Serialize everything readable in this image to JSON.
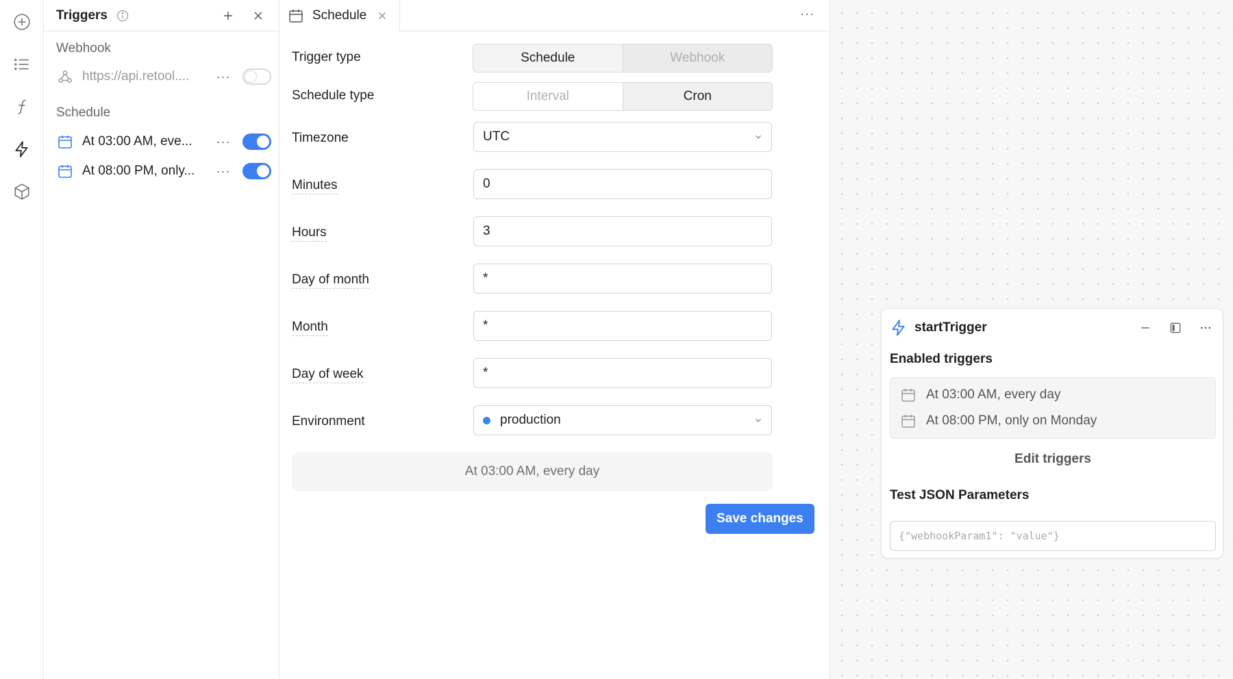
{
  "rail": {
    "items": [
      "add-icon",
      "list-icon",
      "function-icon",
      "bolt-icon",
      "cube-icon"
    ]
  },
  "triggers_panel": {
    "title": "Triggers",
    "webhook_section": "Webhook",
    "webhook_items": [
      {
        "label": "https://api.retool....",
        "enabled": false
      }
    ],
    "schedule_section": "Schedule",
    "schedule_items": [
      {
        "label": "At 03:00 AM, eve...",
        "enabled": true
      },
      {
        "label": "At 08:00 PM, only...",
        "enabled": true
      }
    ],
    "more_label": "···"
  },
  "editor": {
    "tab_label": "Schedule",
    "more_label": "···",
    "trigger_type": {
      "label": "Trigger type",
      "options": [
        "Schedule",
        "Webhook"
      ],
      "selected": "Schedule"
    },
    "schedule_type": {
      "label": "Schedule type",
      "options": [
        "Interval",
        "Cron"
      ],
      "selected": "Cron"
    },
    "timezone": {
      "label": "Timezone",
      "value": "UTC"
    },
    "minutes": {
      "label": "Minutes",
      "value": "0"
    },
    "hours": {
      "label": "Hours",
      "value": "3"
    },
    "day_of_month": {
      "label": "Day of month",
      "value": "*"
    },
    "month": {
      "label": "Month",
      "value": "*"
    },
    "day_of_week": {
      "label": "Day of week",
      "value": "*"
    },
    "environment": {
      "label": "Environment",
      "value": "production",
      "dot_color": "#3b86ea"
    },
    "summary": "At 03:00 AM, every day",
    "save_label": "Save changes"
  },
  "node": {
    "title": "startTrigger",
    "enabled_label": "Enabled triggers",
    "enabled_triggers": [
      "At 03:00 AM, every day",
      "At 08:00 PM, only on Monday"
    ],
    "edit_label": "Edit triggers",
    "test_label": "Test JSON Parameters",
    "json_placeholder": "{\"webhookParam1\": \"value\"}"
  },
  "colors": {
    "accent": "#3b7ff0"
  }
}
